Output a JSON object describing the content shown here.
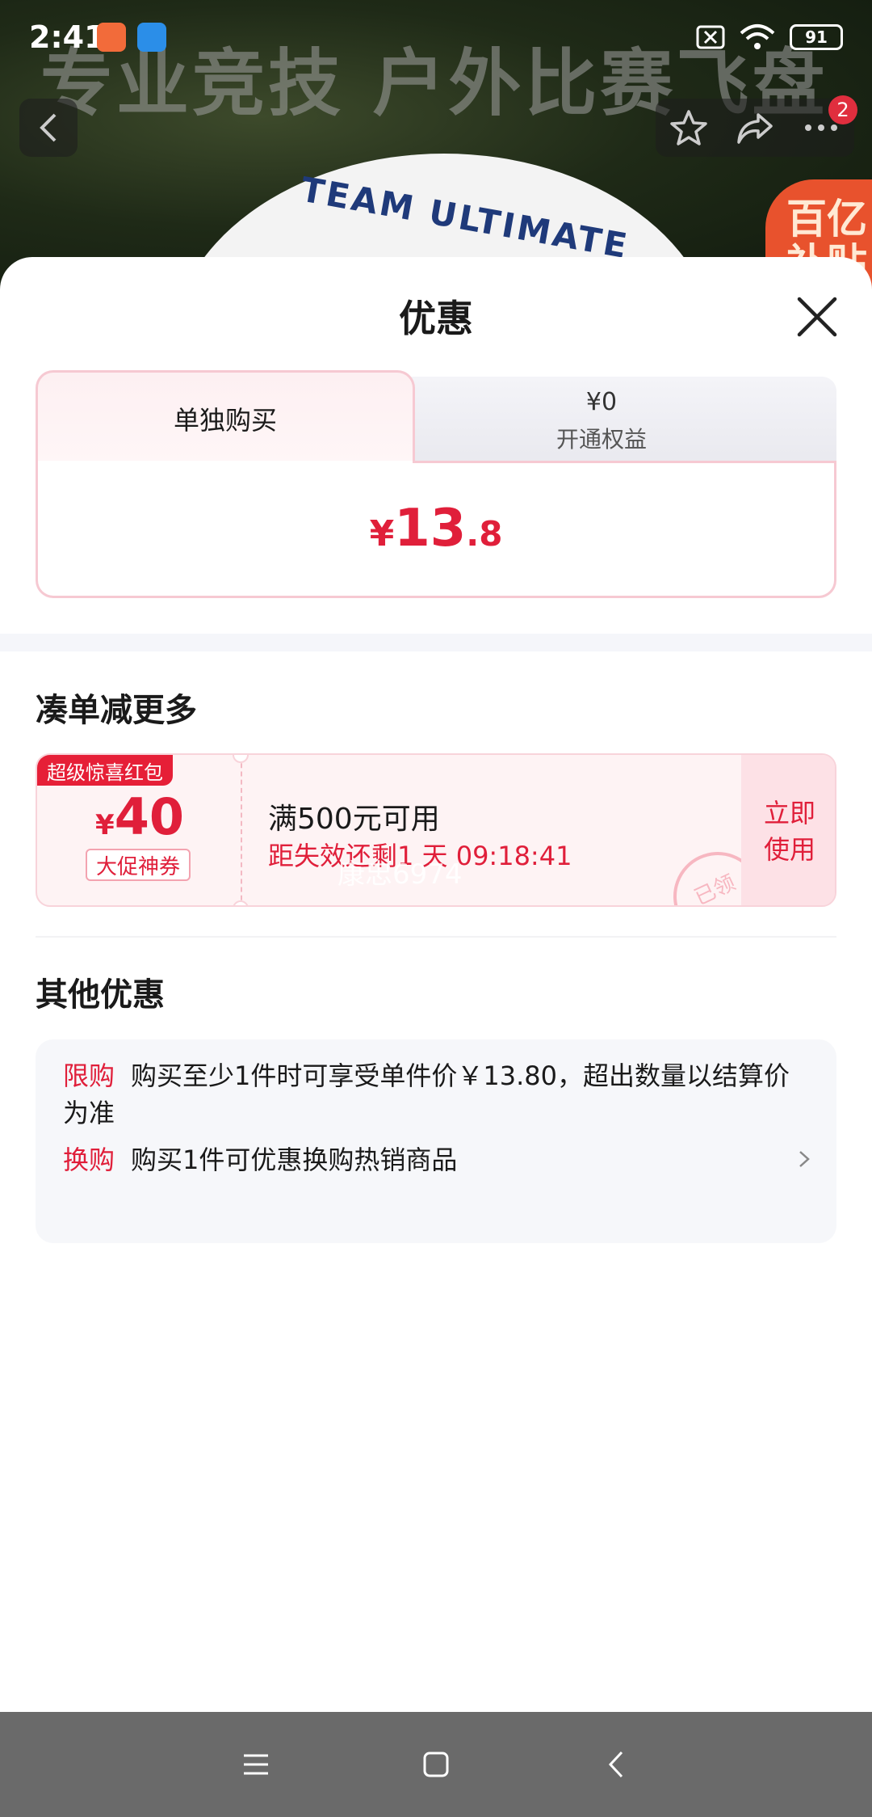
{
  "status_bar": {
    "time": "2:41",
    "battery": "91"
  },
  "banner": {
    "headline": "专业竞技 户外比赛飞盘",
    "disc_text": "TEAM ULTIMATE",
    "promo_badge": "百亿\n补贴"
  },
  "top_nav": {
    "badge_count": "2"
  },
  "sheet": {
    "title": "优惠",
    "tabs": [
      {
        "label": "单独购买",
        "selected": true
      },
      {
        "price": "¥0",
        "label": "开通权益",
        "selected": false
      }
    ],
    "price": {
      "symbol": "¥",
      "integer": "13",
      "decimal": ".8"
    },
    "coupon_section": {
      "heading": "凑单减更多",
      "coupon": {
        "tag": "超级惊喜红包",
        "symbol": "¥",
        "amount": "40",
        "type": "大促神券",
        "condition": "满500元可用",
        "countdown": "距失效还剩1 天 09:18:41",
        "watermark": "康忠6974",
        "stamp": "已领",
        "action": "立即\n使用"
      }
    },
    "other_section": {
      "heading": "其他优惠",
      "items": [
        {
          "tag": "限购",
          "text": "购买至少1件时可享受单件价￥13.80，超出数量以结算价为准"
        },
        {
          "tag": "换购",
          "text": "购买1件可优惠换购热销商品"
        }
      ]
    }
  },
  "colors": {
    "accent": "#e01f3a",
    "tab_border": "#f6c9d2",
    "coupon_bg": "#fef3f4",
    "nav_bar": "#6a6a6a"
  }
}
